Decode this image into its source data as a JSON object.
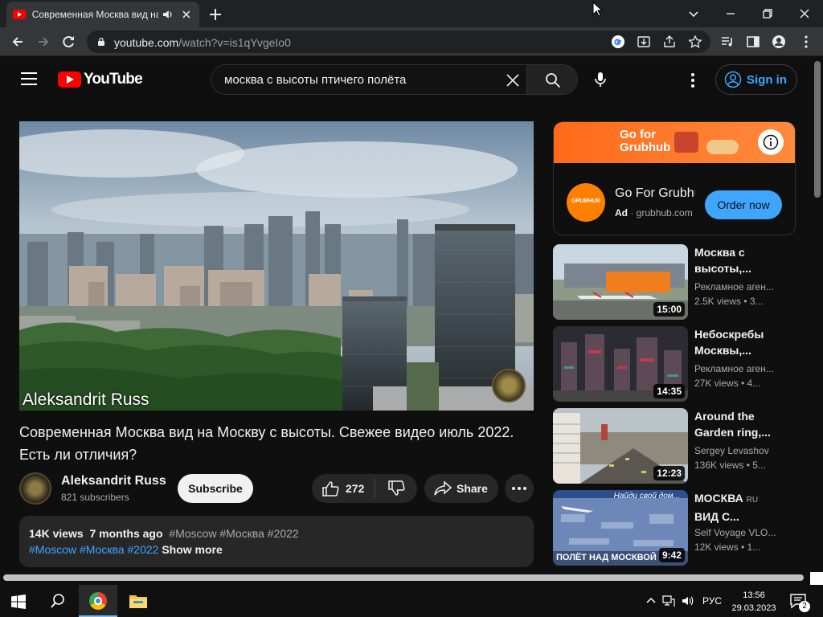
{
  "browser": {
    "tab_title": "Современная Москва вид на",
    "url_host": "youtube.com",
    "url_path": "/watch?v=is1qYvgeIo0"
  },
  "masthead": {
    "logo_text": "YouTube",
    "search_query": "москва с высоты птичего полёта",
    "signin_label": "Sign in"
  },
  "video": {
    "watermark": "Aleksandrit Russ",
    "title": "Современная Москва вид на Москву с высоты. Свежее видео июль 2022. Есть ли отличия?",
    "channel_name": "Aleksandrit Russ",
    "subscribers": "821 subscribers",
    "subscribe_label": "Subscribe",
    "likes": "272",
    "share_label": "Share",
    "views": "14K views",
    "age": "7 months ago",
    "tags_line1": "#Moscow #Москва #2022",
    "tags_line2": "#Moscow #Москва #2022",
    "show_more": "Show more"
  },
  "ad": {
    "banner_text": "Go for Grubhub",
    "logo_text": "GRUBHUB",
    "title": "Go For Grubhub",
    "ad_label": "Ad",
    "domain": "grubhub.com",
    "cta": "Order now"
  },
  "related": [
    {
      "title_line1": "Москва с",
      "title_line2": "высоты,...",
      "badge": "",
      "channel": "Рекламное аген...",
      "meta": "2.5K views • 3...",
      "duration": "15:00"
    },
    {
      "title_line1": "Небоскребы",
      "title_line2": "Москвы,...",
      "badge": "",
      "channel": "Рекламное аген...",
      "meta": "27K views • 4...",
      "duration": "14:35"
    },
    {
      "title_line1": "Around the",
      "title_line2": "Garden ring,...",
      "badge": "",
      "channel": "Sergey Levashov",
      "meta": "136K views • 5...",
      "duration": "12:23"
    },
    {
      "title_line1": "МОСКВА",
      "title_line2": "ВИД С...",
      "badge": "RU",
      "channel": "Self Voyage VLO...",
      "meta": "12K views • 1...",
      "duration": "9:42",
      "overlay": "ПОЛЁТ НАД МОСКВОЙ",
      "overlay2": "Найди свой дом..."
    }
  ],
  "taskbar": {
    "language": "РУС",
    "time": "13:56",
    "date": "29.03.2023",
    "notifications": "2"
  },
  "colors": {
    "accent_link": "#3ea6ff",
    "yt_red": "#ff0000",
    "grubhub_orange": "#ff8000"
  }
}
